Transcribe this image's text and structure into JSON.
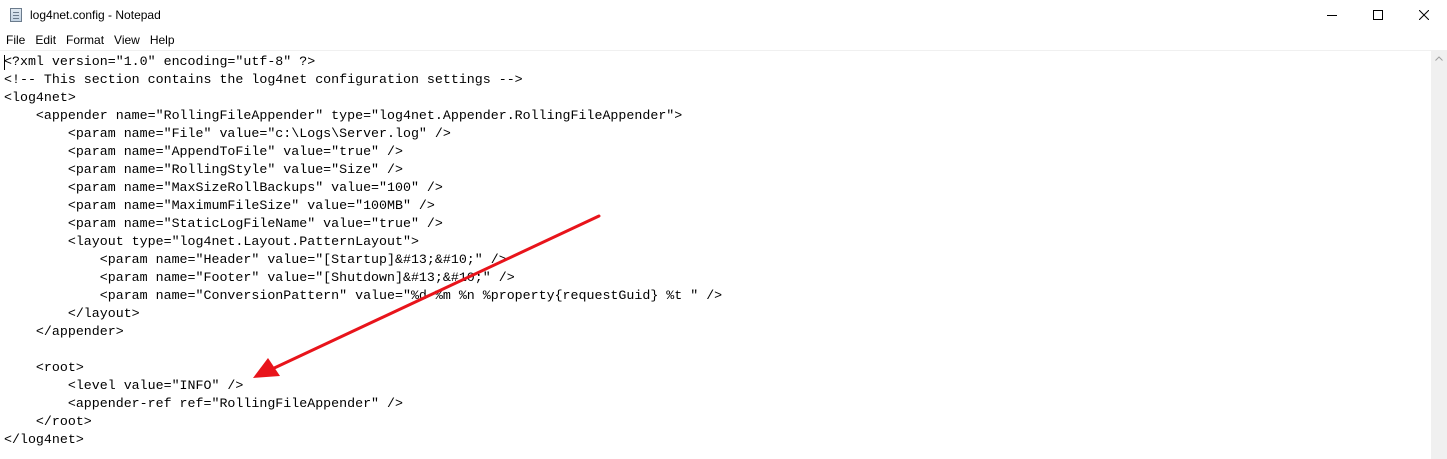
{
  "window": {
    "title": "log4net.config - Notepad",
    "icon": "notepad-icon",
    "controls": [
      "minimize-icon",
      "maximize-icon",
      "close-icon"
    ]
  },
  "menu": {
    "items": [
      "File",
      "Edit",
      "Format",
      "View",
      "Help"
    ]
  },
  "editor": {
    "lines": [
      "<?xml version=\"1.0\" encoding=\"utf-8\" ?>",
      "<!-- This section contains the log4net configuration settings -->",
      "<log4net>",
      "    <appender name=\"RollingFileAppender\" type=\"log4net.Appender.RollingFileAppender\">",
      "        <param name=\"File\" value=\"c:\\Logs\\Server.log\" />",
      "        <param name=\"AppendToFile\" value=\"true\" />",
      "        <param name=\"RollingStyle\" value=\"Size\" />",
      "        <param name=\"MaxSizeRollBackups\" value=\"100\" />",
      "        <param name=\"MaximumFileSize\" value=\"100MB\" />",
      "        <param name=\"StaticLogFileName\" value=\"true\" />",
      "        <layout type=\"log4net.Layout.PatternLayout\">",
      "            <param name=\"Header\" value=\"[Startup]&#13;&#10;\" />",
      "            <param name=\"Footer\" value=\"[Shutdown]&#13;&#10;\" />",
      "            <param name=\"ConversionPattern\" value=\"%d %m %n %property{requestGuid} %t \" />",
      "        </layout>",
      "    </appender>",
      "",
      "    <root>",
      "        <level value=\"INFO\" />",
      "        <appender-ref ref=\"RollingFileAppender\" />",
      "    </root>",
      "</log4net>"
    ]
  },
  "annotation": {
    "color": "#e8141b",
    "points_to": "level value line"
  }
}
